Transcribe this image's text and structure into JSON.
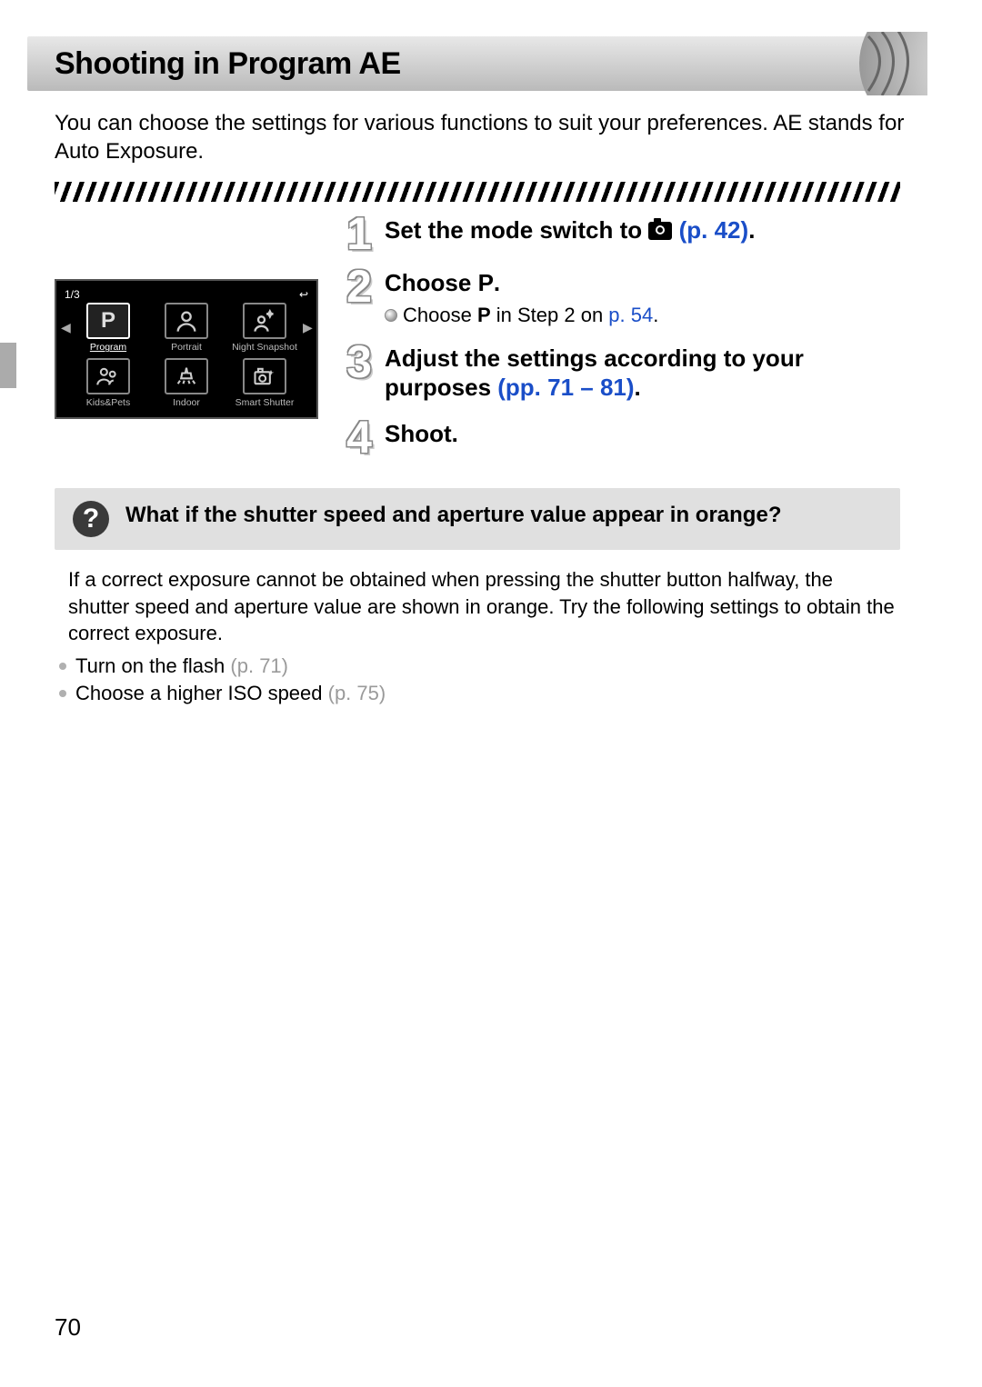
{
  "page_number": "70",
  "heading": "Shooting in Program AE",
  "intro": "You can choose the settings for various functions to suit your preferences. AE stands for Auto Exposure.",
  "camera_menu": {
    "page_indicator": "1/3",
    "return_icon": "↩",
    "items_row1": [
      {
        "icon": "P",
        "label": "Program",
        "selected": true
      },
      {
        "icon": "face",
        "label": "Portrait",
        "selected": false
      },
      {
        "icon": "night",
        "label": "Night Snapshot",
        "selected": false
      }
    ],
    "items_row2": [
      {
        "icon": "kids",
        "label": "Kids&Pets",
        "selected": false
      },
      {
        "icon": "indoor",
        "label": "Indoor",
        "selected": false
      },
      {
        "icon": "smart",
        "label": "Smart Shutter",
        "selected": false
      }
    ]
  },
  "steps": [
    {
      "num": "1",
      "title_pre": "Set the mode switch to ",
      "title_post": " ",
      "link": "(p. 42)",
      "period": "."
    },
    {
      "num": "2",
      "title": "Choose ",
      "title_icon": "P",
      "title_post": ".",
      "sub_pre": "Choose ",
      "sub_icon": "P",
      "sub_mid": " in Step 2 on ",
      "sub_link": "p. 54",
      "sub_post": "."
    },
    {
      "num": "3",
      "title_pre": "Adjust the settings according to your purposes ",
      "link": "(pp. 71 – 81)",
      "period": "."
    },
    {
      "num": "4",
      "title": "Shoot."
    }
  ],
  "callout": {
    "icon": "?",
    "text": "What if the shutter speed and aperture value appear in orange?"
  },
  "explanation": "If a correct exposure cannot be obtained when pressing the shutter button halfway, the shutter speed and aperture value are shown in orange. Try the following settings to obtain the correct exposure.",
  "tips": [
    {
      "text": "Turn on the flash ",
      "link": "(p. 71)"
    },
    {
      "text": "Choose a higher ISO speed ",
      "link": "(p. 75)"
    }
  ]
}
